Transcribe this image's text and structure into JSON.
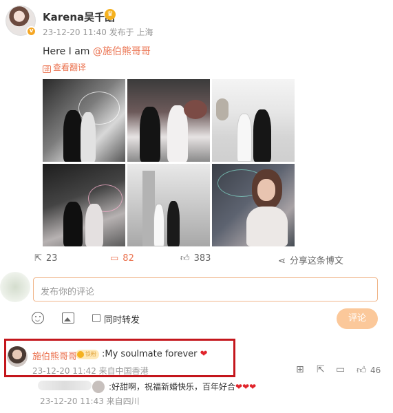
{
  "post": {
    "author": "Karena吴千語",
    "time_location": "23-12-20 11:40 发布于 上海",
    "text_prefix": "Here I am ",
    "mention": "@施伯熊哥哥",
    "translate_label": "查看翻译",
    "photos": [
      "wedding-photo-1",
      "wedding-photo-2",
      "wedding-photo-3",
      "wedding-photo-4",
      "wedding-photo-5",
      "wedding-photo-6"
    ]
  },
  "actions": {
    "repost_count": "23",
    "comment_count": "82",
    "like_count": "383",
    "share_label": "分享这条博文"
  },
  "comment_box": {
    "placeholder": "发布你的评论",
    "also_repost_label": "同时转发",
    "submit_label": "评论"
  },
  "top_comment": {
    "name": "施伯熊哥哥",
    "badge": "铁粉",
    "text": ":My soulmate forever",
    "heart": "❤",
    "time_location": "23-12-20 11:42 来自中国香港",
    "like_count": "46"
  },
  "reply": {
    "text": ":好甜啊，祝福新婚快乐，百年好合",
    "hearts": "❤❤❤",
    "time_location": "23-12-20 11:43 来自四川"
  },
  "colors": {
    "accent": "#eb7350",
    "highlight_border": "#c4161c",
    "input_border": "#f0b589",
    "submit_bg": "#fbc89a"
  }
}
